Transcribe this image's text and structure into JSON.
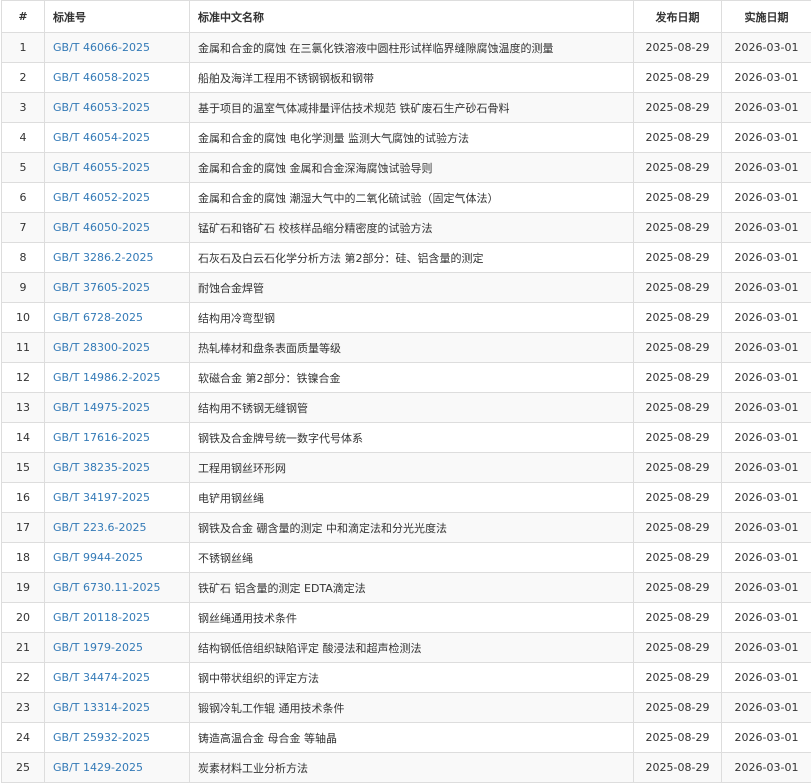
{
  "table": {
    "headers": {
      "index": "#",
      "code": "标准号",
      "name": "标准中文名称",
      "publish_date": "发布日期",
      "impl_date": "实施日期"
    },
    "rows": [
      {
        "index": "1",
        "code": "GB/T 46066-2025",
        "name": "金属和合金的腐蚀 在三氯化铁溶液中圆柱形试样临界缝隙腐蚀温度的测量",
        "publish_date": "2025-08-29",
        "impl_date": "2026-03-01"
      },
      {
        "index": "2",
        "code": "GB/T 46058-2025",
        "name": "船舶及海洋工程用不锈钢钢板和钢带",
        "publish_date": "2025-08-29",
        "impl_date": "2026-03-01"
      },
      {
        "index": "3",
        "code": "GB/T 46053-2025",
        "name": "基于项目的温室气体减排量评估技术规范 铁矿废石生产砂石骨料",
        "publish_date": "2025-08-29",
        "impl_date": "2026-03-01"
      },
      {
        "index": "4",
        "code": "GB/T 46054-2025",
        "name": "金属和合金的腐蚀 电化学测量 监测大气腐蚀的试验方法",
        "publish_date": "2025-08-29",
        "impl_date": "2026-03-01"
      },
      {
        "index": "5",
        "code": "GB/T 46055-2025",
        "name": "金属和合金的腐蚀 金属和合金深海腐蚀试验导则",
        "publish_date": "2025-08-29",
        "impl_date": "2026-03-01"
      },
      {
        "index": "6",
        "code": "GB/T 46052-2025",
        "name": "金属和合金的腐蚀 潮湿大气中的二氧化硫试验（固定气体法）",
        "publish_date": "2025-08-29",
        "impl_date": "2026-03-01"
      },
      {
        "index": "7",
        "code": "GB/T 46050-2025",
        "name": "锰矿石和铬矿石 校核样品缩分精密度的试验方法",
        "publish_date": "2025-08-29",
        "impl_date": "2026-03-01"
      },
      {
        "index": "8",
        "code": "GB/T 3286.2-2025",
        "name": "石灰石及白云石化学分析方法 第2部分：硅、铝含量的测定",
        "publish_date": "2025-08-29",
        "impl_date": "2026-03-01"
      },
      {
        "index": "9",
        "code": "GB/T 37605-2025",
        "name": "耐蚀合金焊管",
        "publish_date": "2025-08-29",
        "impl_date": "2026-03-01"
      },
      {
        "index": "10",
        "code": "GB/T 6728-2025",
        "name": "结构用冷弯型钢",
        "publish_date": "2025-08-29",
        "impl_date": "2026-03-01"
      },
      {
        "index": "11",
        "code": "GB/T 28300-2025",
        "name": "热轧棒材和盘条表面质量等级",
        "publish_date": "2025-08-29",
        "impl_date": "2026-03-01"
      },
      {
        "index": "12",
        "code": "GB/T 14986.2-2025",
        "name": "软磁合金 第2部分：铁镍合金",
        "publish_date": "2025-08-29",
        "impl_date": "2026-03-01"
      },
      {
        "index": "13",
        "code": "GB/T 14975-2025",
        "name": "结构用不锈钢无缝钢管",
        "publish_date": "2025-08-29",
        "impl_date": "2026-03-01"
      },
      {
        "index": "14",
        "code": "GB/T 17616-2025",
        "name": "钢铁及合金牌号统一数字代号体系",
        "publish_date": "2025-08-29",
        "impl_date": "2026-03-01"
      },
      {
        "index": "15",
        "code": "GB/T 38235-2025",
        "name": "工程用钢丝环形网",
        "publish_date": "2025-08-29",
        "impl_date": "2026-03-01"
      },
      {
        "index": "16",
        "code": "GB/T 34197-2025",
        "name": "电铲用钢丝绳",
        "publish_date": "2025-08-29",
        "impl_date": "2026-03-01"
      },
      {
        "index": "17",
        "code": "GB/T 223.6-2025",
        "name": "钢铁及合金 硼含量的测定 中和滴定法和分光光度法",
        "publish_date": "2025-08-29",
        "impl_date": "2026-03-01"
      },
      {
        "index": "18",
        "code": "GB/T 9944-2025",
        "name": "不锈钢丝绳",
        "publish_date": "2025-08-29",
        "impl_date": "2026-03-01"
      },
      {
        "index": "19",
        "code": "GB/T 6730.11-2025",
        "name": "铁矿石 铝含量的测定 EDTA滴定法",
        "publish_date": "2025-08-29",
        "impl_date": "2026-03-01"
      },
      {
        "index": "20",
        "code": "GB/T 20118-2025",
        "name": "钢丝绳通用技术条件",
        "publish_date": "2025-08-29",
        "impl_date": "2026-03-01"
      },
      {
        "index": "21",
        "code": "GB/T 1979-2025",
        "name": "结构钢低倍组织缺陷评定 酸浸法和超声检测法",
        "publish_date": "2025-08-29",
        "impl_date": "2026-03-01"
      },
      {
        "index": "22",
        "code": "GB/T 34474-2025",
        "name": "钢中带状组织的评定方法",
        "publish_date": "2025-08-29",
        "impl_date": "2026-03-01"
      },
      {
        "index": "23",
        "code": "GB/T 13314-2025",
        "name": "锻钢冷轧工作辊 通用技术条件",
        "publish_date": "2025-08-29",
        "impl_date": "2026-03-01"
      },
      {
        "index": "24",
        "code": "GB/T 25932-2025",
        "name": "铸造高温合金 母合金 等轴晶",
        "publish_date": "2025-08-29",
        "impl_date": "2026-03-01"
      },
      {
        "index": "25",
        "code": "GB/T 1429-2025",
        "name": "炭素材料工业分析方法",
        "publish_date": "2025-08-29",
        "impl_date": "2026-03-01"
      }
    ]
  },
  "colors": {
    "link": "#337ab7",
    "border": "#dddddd",
    "stripe": "#f9f9f9",
    "text": "#333333"
  }
}
